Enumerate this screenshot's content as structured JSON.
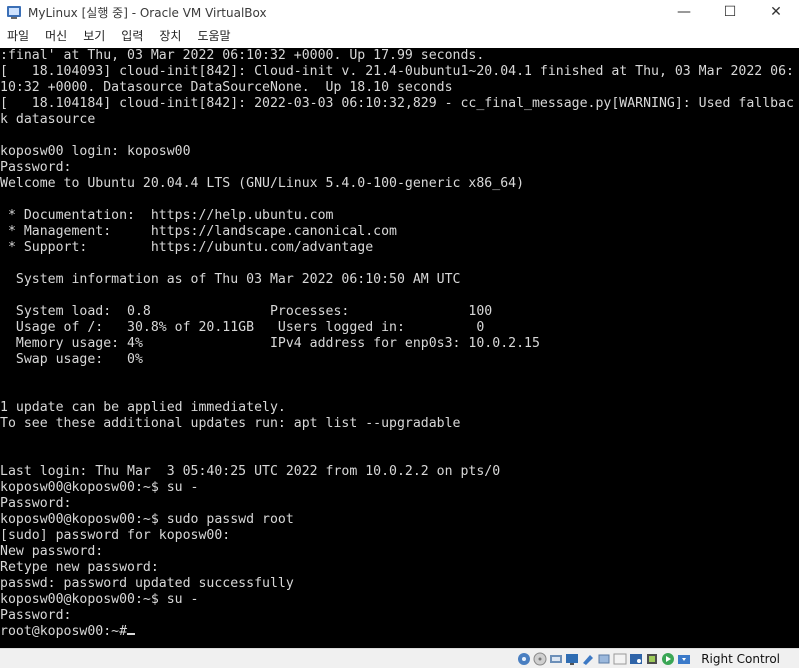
{
  "window": {
    "title": "MyLinux [실행 중] - Oracle VM VirtualBox",
    "controls": {
      "minimize": "—",
      "maximize": "☐",
      "close": "✕"
    }
  },
  "menu": [
    "파일",
    "머신",
    "보기",
    "입력",
    "장치",
    "도움말"
  ],
  "console": {
    "lines": [
      ":final' at Thu, 03 Mar 2022 06:10:32 +0000. Up 17.99 seconds.",
      "[   18.104093] cloud-init[842]: Cloud-init v. 21.4-0ubuntu1~20.04.1 finished at Thu, 03 Mar 2022 06:",
      "10:32 +0000. Datasource DataSourceNone.  Up 18.10 seconds",
      "[   18.104184] cloud-init[842]: 2022-03-03 06:10:32,829 - cc_final_message.py[WARNING]: Used fallbac",
      "k datasource",
      "",
      "koposw00 login: koposw00",
      "Password:",
      "Welcome to Ubuntu 20.04.4 LTS (GNU/Linux 5.4.0-100-generic x86_64)",
      "",
      " * Documentation:  https://help.ubuntu.com",
      " * Management:     https://landscape.canonical.com",
      " * Support:        https://ubuntu.com/advantage",
      "",
      "  System information as of Thu 03 Mar 2022 06:10:50 AM UTC",
      "",
      "  System load:  0.8               Processes:               100",
      "  Usage of /:   30.8% of 20.11GB   Users logged in:         0",
      "  Memory usage: 4%                IPv4 address for enp0s3: 10.0.2.15",
      "  Swap usage:   0%",
      "",
      "",
      "1 update can be applied immediately.",
      "To see these additional updates run: apt list --upgradable",
      "",
      "",
      "Last login: Thu Mar  3 05:40:25 UTC 2022 from 10.0.2.2 on pts/0",
      "koposw00@koposw00:~$ su -",
      "Password:",
      "koposw00@koposw00:~$ sudo passwd root",
      "[sudo] password for koposw00:",
      "New password:",
      "Retype new password:",
      "passwd: password updated successfully",
      "koposw00@koposw00:~$ su -",
      "Password:",
      "root@koposw00:~#"
    ]
  },
  "statusbar": {
    "icons": [
      "hard-disk-icon",
      "optical-drive-icon",
      "audio-icon",
      "network-icon",
      "shared-folder-icon",
      "usb-icon",
      "display-icon",
      "video-capture-icon",
      "cpu-icon",
      "mouse-integration-icon",
      "keyboard-icon"
    ],
    "host_key": "Right Control"
  }
}
